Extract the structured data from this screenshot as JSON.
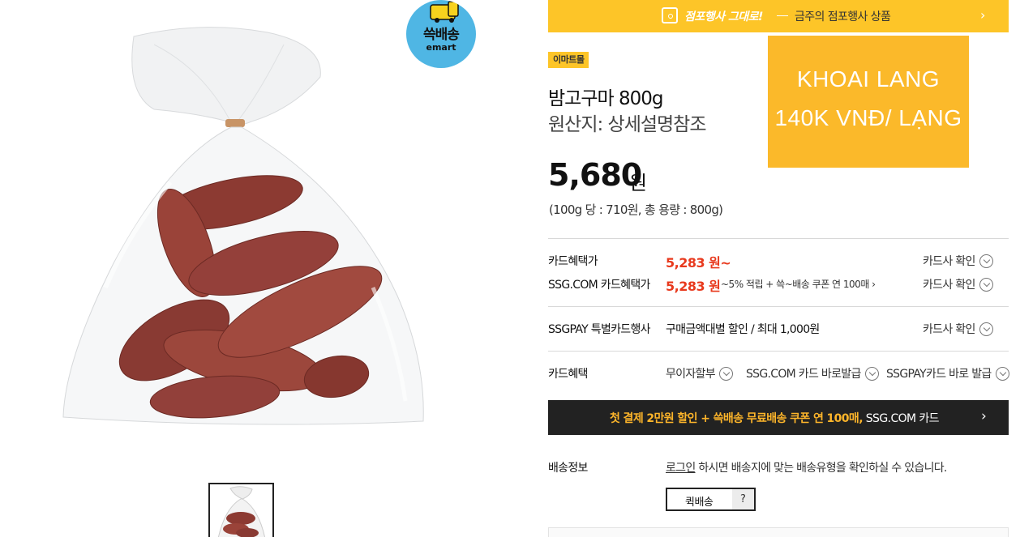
{
  "badge": {
    "line1": "쓱배송",
    "line2": "emart"
  },
  "top_bar": {
    "highlight": "점포행사 그대로!",
    "text": "금주의 점포행사 상품"
  },
  "seller_tag": "이마트몰",
  "product": {
    "title": "밤고구마 800g",
    "origin": "원산지: 상세설명참조",
    "price": "5,680",
    "currency": "원",
    "unit_price": "(100g 당 : 710원, 총 용량 : 800g)"
  },
  "overlay": {
    "line1": "KHOAI LANG",
    "line2": "140K VNĐ/ LẠNG"
  },
  "card_benefit": {
    "label": "카드혜택가",
    "value": "5,283 원~",
    "check": "카드사 확인"
  },
  "ssg_benefit": {
    "label": "SSG.COM 카드혜택가",
    "value": "5,283 원",
    "note": "~5% 적립 + 쓱~배송 쿠폰 연 100매 ›",
    "check": "카드사 확인"
  },
  "ssgpay": {
    "label": "SSGPAY 특별카드행사",
    "value": "구매금액대별 할인 / 최대 1,000원",
    "check": "카드사 확인"
  },
  "card_options": {
    "label": "카드혜택",
    "items": [
      "무이자할부",
      "SSG.COM 카드 바로발급",
      "SSGPAY카드 바로 발급"
    ]
  },
  "promo": {
    "highlight": "첫 결제 2만원 할인 + 쓱배송 무료배송 쿠폰 연 100매,",
    "suffix": " SSG.COM 카드"
  },
  "delivery": {
    "label": "배송정보",
    "login_link": "로그인",
    "message": " 하시면 배송지에 맞는 배송유형을 확인하실 수 있습니다.",
    "quick_label": "퀵배송",
    "help": "?"
  }
}
